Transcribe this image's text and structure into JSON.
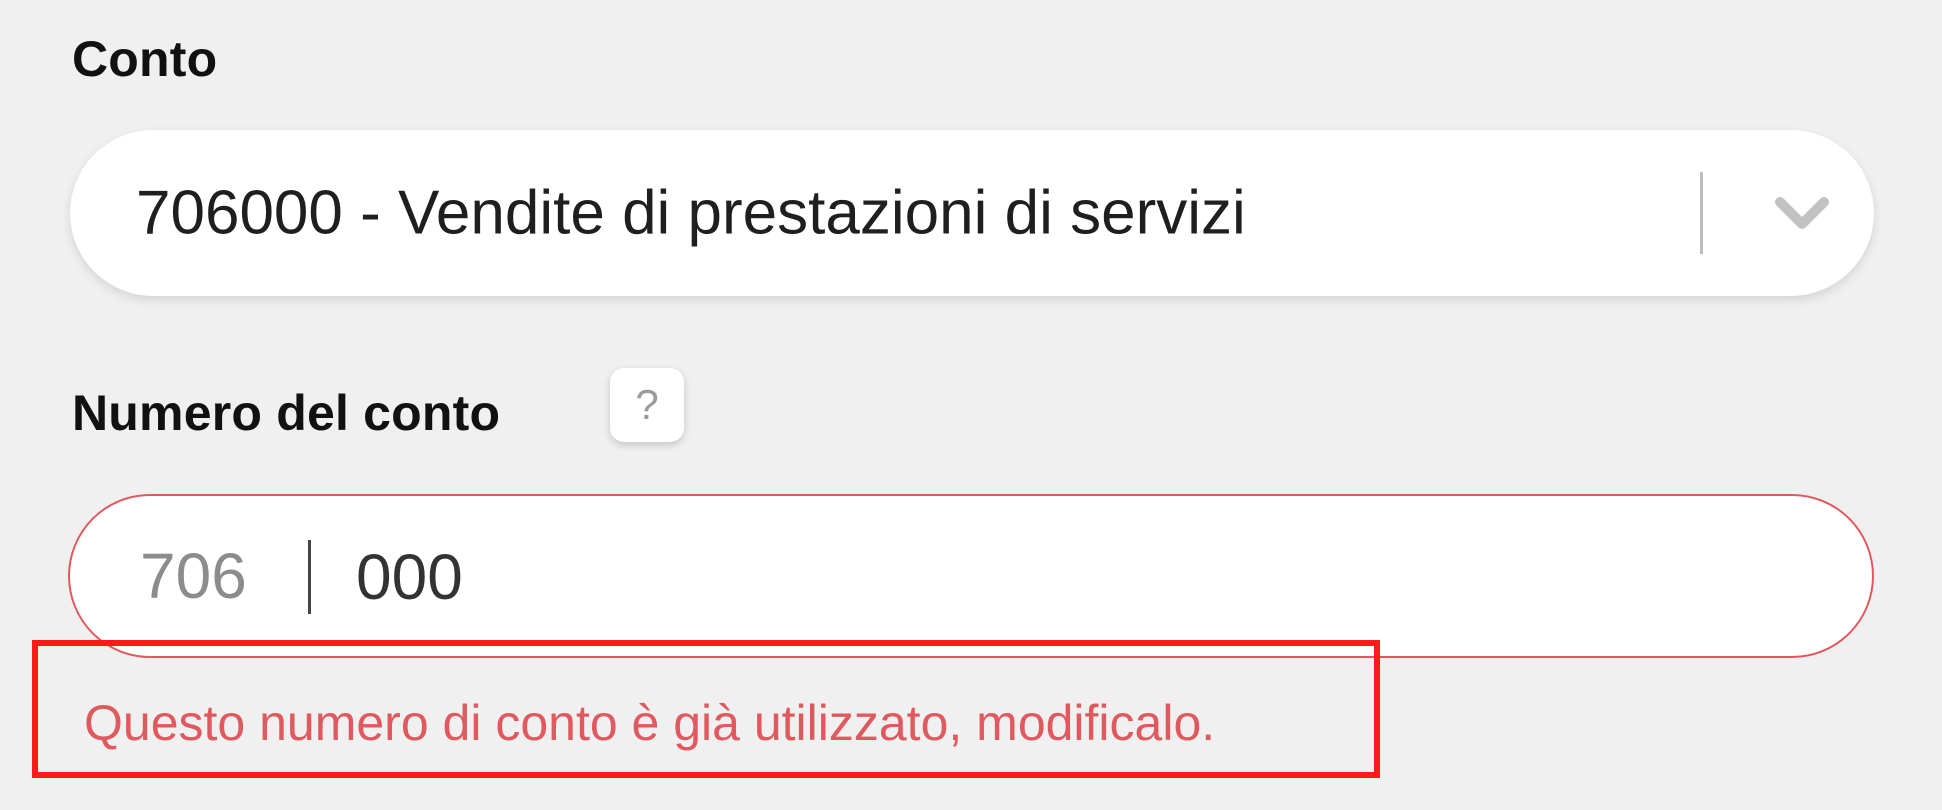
{
  "account_select": {
    "label": "Conto",
    "value": "706000 - Vendite di prestazioni di servizi",
    "dropdown_icon": "chevron-down-icon"
  },
  "account_number": {
    "label": "Numero del conto",
    "help_label": "?",
    "help_icon": "question-mark-icon",
    "prefix": "706",
    "value": "000",
    "error_message": "Questo numero di conto è già utilizzato, modificalo."
  },
  "colors": {
    "background": "#f0f0f0",
    "error": "#e0595e",
    "highlight_box": "#ff1a1a"
  }
}
